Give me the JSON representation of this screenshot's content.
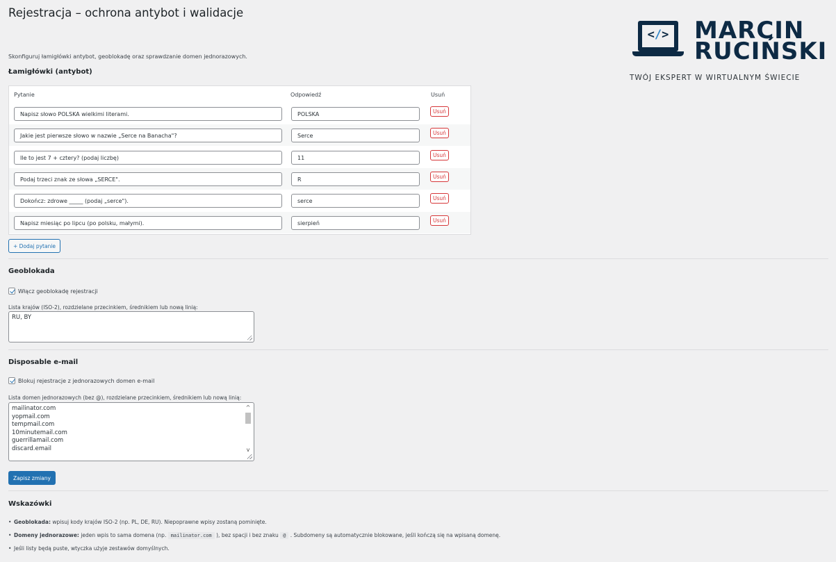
{
  "page": {
    "title": "Rejestracja – ochrona antybot i walidacje",
    "intro": "Skonfiguruj łamigłówki antybot, geoblokadę oraz sprawdzanie domen jednorazowych."
  },
  "logo": {
    "code": "</>",
    "name_line1": "MARCIN",
    "name_line2": "RUCIŃSKI",
    "tagline": "TWÓJ EKSPERT W WIRTUALNYM ŚWIECIE",
    "colors": {
      "navy": "#0d2a44",
      "accent": "#2f86c9"
    }
  },
  "antybot": {
    "title": "Łamigłówki (antybot)",
    "columns": {
      "question": "Pytanie",
      "answer": "Odpowiedź",
      "delete": "Usuń"
    },
    "rows": [
      {
        "question": "Napisz słowo POLSKA wielkimi literami.",
        "answer": "POLSKA",
        "delete": "Usuń"
      },
      {
        "question": "Jakie jest pierwsze słowo w nazwie „Serce na Banacha\"?",
        "answer": "Serce",
        "delete": "Usuń"
      },
      {
        "question": "Ile to jest 7 + cztery? (podaj liczbę)",
        "answer": "11",
        "delete": "Usuń"
      },
      {
        "question": "Podaj trzeci znak ze słowa „SERCE\".",
        "answer": "R",
        "delete": "Usuń"
      },
      {
        "question": "Dokończ: zdrowe _____ (podaj „serce\").",
        "answer": "serce",
        "delete": "Usuń"
      },
      {
        "question": "Napisz miesiąc po lipcu (po polsku, małymi).",
        "answer": "sierpień",
        "delete": "Usuń"
      }
    ],
    "add_button": "+ Dodaj pytanie"
  },
  "geo": {
    "title": "Geoblokada",
    "checkbox_label": "Włącz geoblokadę rejestracji",
    "checked": true,
    "list_label": "Lista krajów (ISO-2), rozdzielane przecinkiem, średnikiem lub nową linią:",
    "list_value": "RU, BY"
  },
  "disposable": {
    "title": "Disposable e-mail",
    "checkbox_label": "Blokuj rejestracje z jednorazowych domen e-mail",
    "checked": true,
    "list_label": "Lista domen jednorazowych (bez @), rozdzielane przecinkiem, średnikiem lub nową linią:",
    "domains": [
      "mailinator.com",
      "yopmail.com",
      "tempmail.com",
      "10minutemail.com",
      "guerrillamail.com",
      "discard.email"
    ]
  },
  "save_button": "Zapisz zmiany",
  "tips": {
    "title": "Wskazówki",
    "items": [
      {
        "bold": "Geoblokada:",
        "text": " wpisuj kody krajów ISO-2 (np. PL, DE, RU). Niepoprawne wpisy zostaną pominięte."
      },
      {
        "bold": "Domeny jednorazowe:",
        "text_before": " jeden wpis to sama domena (np. ",
        "code1": "mailinator.com",
        "text_mid": " ), bez spacji i bez znaku ",
        "code2": "@",
        "text_after": " . Subdomeny są automatycznie blokowane, jeśli kończą się na wpisaną domenę."
      },
      {
        "text": "Jeśli listy będą puste, wtyczka użyje zestawów domyślnych."
      }
    ]
  },
  "colors": {
    "primary": "#2271b1",
    "danger": "#d63638",
    "background": "#f0f0f1"
  }
}
